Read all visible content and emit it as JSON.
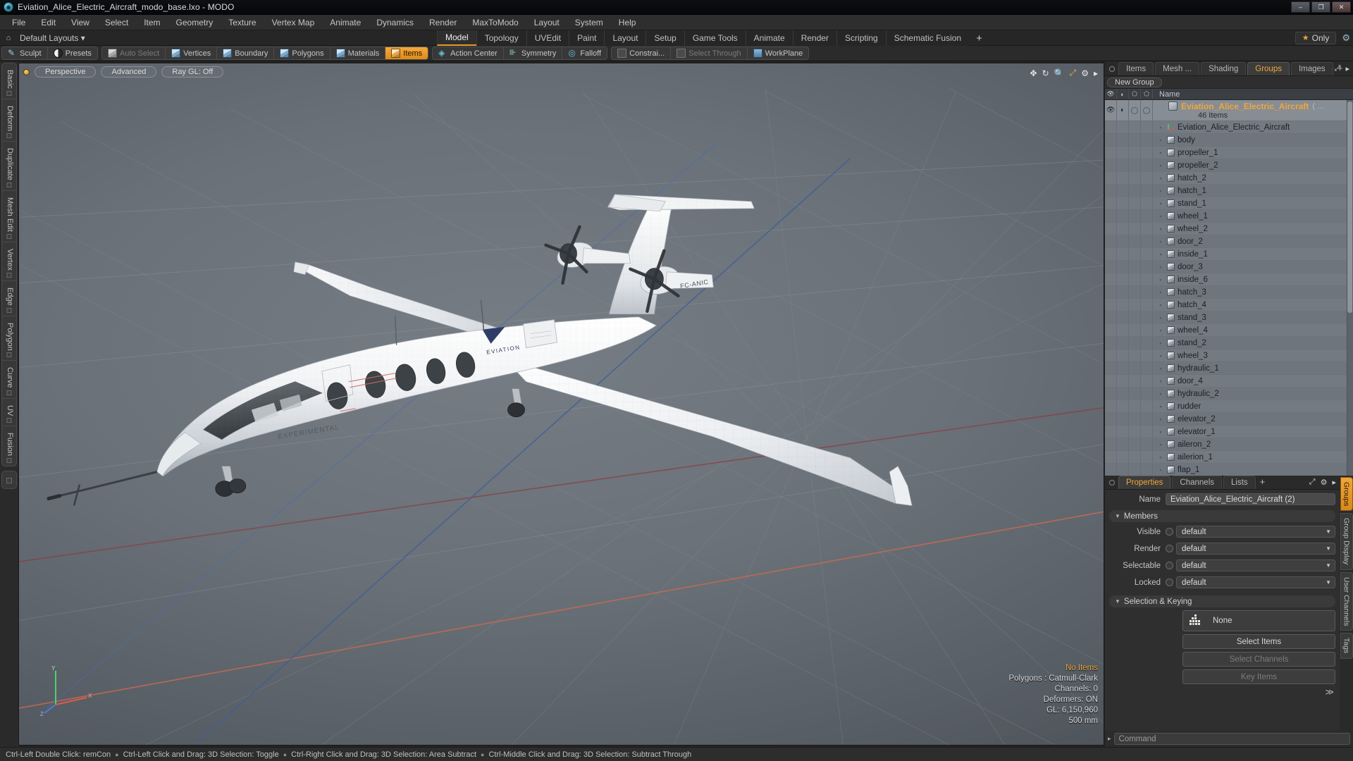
{
  "titlebar": {
    "title": "Eviation_Alice_Electric_Aircraft_modo_base.lxo - MODO",
    "app_icon": "modo-logo-icon",
    "minimize": "–",
    "maximize": "❐",
    "close": "✕"
  },
  "menubar": {
    "items": [
      "File",
      "Edit",
      "View",
      "Select",
      "Item",
      "Geometry",
      "Texture",
      "Vertex Map",
      "Animate",
      "Dynamics",
      "Render",
      "MaxToModo",
      "Layout",
      "System",
      "Help"
    ]
  },
  "layoutbar": {
    "home_icon": "home-icon",
    "layouts_label": "Default Layouts ▾",
    "tabs": [
      {
        "label": "Model",
        "active": true
      },
      {
        "label": "Topology",
        "active": false
      },
      {
        "label": "UVEdit",
        "active": false
      },
      {
        "label": "Paint",
        "active": false
      },
      {
        "label": "Layout",
        "active": false
      },
      {
        "label": "Setup",
        "active": false
      },
      {
        "label": "Game Tools",
        "active": false
      },
      {
        "label": "Animate",
        "active": false
      },
      {
        "label": "Render",
        "active": false
      },
      {
        "label": "Scripting",
        "active": false
      },
      {
        "label": "Schematic Fusion",
        "active": false
      }
    ],
    "add_tab": "+",
    "only_label": "Only",
    "star_icon": "star-icon",
    "gear_icon": "gear-icon"
  },
  "modebar": {
    "group1": [
      {
        "label": "Sculpt",
        "icon": "sculpt-icon",
        "active": false,
        "dim": false
      },
      {
        "label": "Presets",
        "icon": "presets-sphere-icon",
        "active": false,
        "dim": false
      }
    ],
    "group2": [
      {
        "label": "Auto Select",
        "icon": "grey-cube-icon",
        "active": false,
        "dim": true
      },
      {
        "label": "Vertices",
        "icon": "blue-cube-icon",
        "active": false,
        "dim": false
      },
      {
        "label": "Boundary",
        "icon": "blue-cube-icon",
        "active": false,
        "dim": false
      },
      {
        "label": "Polygons",
        "icon": "blue-cube-icon",
        "active": false,
        "dim": false
      },
      {
        "label": "Materials",
        "icon": "blue-cube-icon",
        "active": false,
        "dim": false
      },
      {
        "label": "Items",
        "icon": "orange-cube-icon",
        "active": true,
        "dim": false
      }
    ],
    "group3": [
      {
        "label": "Action Center",
        "icon": "action-center-icon",
        "active": false,
        "dim": false
      },
      {
        "label": "Symmetry",
        "icon": "symmetry-icon",
        "active": false,
        "dim": false
      },
      {
        "label": "Falloff",
        "icon": "falloff-icon",
        "active": false,
        "dim": false
      }
    ],
    "group4": [
      {
        "label": "Constrai...",
        "icon": "constraint-icon",
        "active": false,
        "dim": false
      },
      {
        "label": "Select Through",
        "icon": "select-through-icon",
        "active": false,
        "dim": true
      },
      {
        "label": "WorkPlane",
        "icon": "workplane-icon",
        "active": false,
        "dim": false
      }
    ]
  },
  "left_tabs": {
    "items": [
      "Basic",
      "Deform",
      "Duplicate",
      "Mesh Edit",
      "Vertex",
      "Edge",
      "Polygon",
      "Curve",
      "UV",
      "Fusion"
    ]
  },
  "viewport": {
    "dot_icon": "viewport-active-dot-icon",
    "pills": [
      "Perspective",
      "Advanced",
      "Ray GL: Off"
    ],
    "tool_icons": [
      "move-view-icon",
      "rotate-view-icon",
      "zoom-view-icon",
      "fit-view-icon",
      "gear-icon",
      "chevron-right-icon"
    ],
    "stats": {
      "no_items": "No Items",
      "polygons": "Polygons : Catmull-Clark",
      "channels": "Channels: 0",
      "deformers": "Deformers: ON",
      "gl": "GL: 6,150,960",
      "scale": "500 mm"
    },
    "model_text": {
      "experimental": "EXPERIMENTAL",
      "eviation": "EVIATION",
      "tail_code": "FC-ANIC"
    },
    "axis_labels": [
      "Y",
      "X",
      "Z"
    ]
  },
  "right_panel": {
    "tabs": [
      {
        "label": "Items",
        "active": false
      },
      {
        "label": "Mesh ...",
        "active": false
      },
      {
        "label": "Shading",
        "active": false
      },
      {
        "label": "Groups",
        "active": true
      },
      {
        "label": "Images",
        "active": false
      }
    ],
    "add_tab": "+",
    "corner_icons": [
      "expand-icon",
      "chevron-right-icon"
    ],
    "new_group_label": "New Group",
    "columns": {
      "visible_icon": "eye-icon",
      "render_icon": "render-icon",
      "selectable_icon": "selectable-cube-icon",
      "locked_icon": "locked-cube-icon",
      "name": "Name"
    },
    "group": {
      "name": "Eviation_Alice_Electric_Aircraft",
      "suffix": "( ...",
      "count": "46 Items"
    },
    "items": [
      {
        "name": "Eviation_Alice_Electric_Aircraft",
        "icon": "locator-axis-icon"
      },
      {
        "name": "body",
        "icon": "mesh-cube-icon"
      },
      {
        "name": "propeller_1",
        "icon": "mesh-cube-icon"
      },
      {
        "name": "propeller_2",
        "icon": "mesh-cube-icon"
      },
      {
        "name": "hatch_2",
        "icon": "mesh-cube-icon"
      },
      {
        "name": "hatch_1",
        "icon": "mesh-cube-icon"
      },
      {
        "name": "stand_1",
        "icon": "mesh-cube-icon"
      },
      {
        "name": "wheel_1",
        "icon": "mesh-cube-icon"
      },
      {
        "name": "wheel_2",
        "icon": "mesh-cube-icon"
      },
      {
        "name": "door_2",
        "icon": "mesh-cube-icon"
      },
      {
        "name": "inside_1",
        "icon": "mesh-cube-icon"
      },
      {
        "name": "door_3",
        "icon": "mesh-cube-icon"
      },
      {
        "name": "inside_6",
        "icon": "mesh-cube-icon"
      },
      {
        "name": "hatch_3",
        "icon": "mesh-cube-icon"
      },
      {
        "name": "hatch_4",
        "icon": "mesh-cube-icon"
      },
      {
        "name": "stand_3",
        "icon": "mesh-cube-icon"
      },
      {
        "name": "wheel_4",
        "icon": "mesh-cube-icon"
      },
      {
        "name": "stand_2",
        "icon": "mesh-cube-icon"
      },
      {
        "name": "wheel_3",
        "icon": "mesh-cube-icon"
      },
      {
        "name": "hydraulic_1",
        "icon": "mesh-cube-icon"
      },
      {
        "name": "door_4",
        "icon": "mesh-cube-icon"
      },
      {
        "name": "hydraulic_2",
        "icon": "mesh-cube-icon"
      },
      {
        "name": "rudder",
        "icon": "mesh-cube-icon"
      },
      {
        "name": "elevator_2",
        "icon": "mesh-cube-icon"
      },
      {
        "name": "elevator_1",
        "icon": "mesh-cube-icon"
      },
      {
        "name": "aileron_2",
        "icon": "mesh-cube-icon"
      },
      {
        "name": "ailerion_1",
        "icon": "mesh-cube-icon"
      },
      {
        "name": "flap_1",
        "icon": "mesh-cube-icon"
      }
    ]
  },
  "properties": {
    "tabs": [
      {
        "label": "Properties",
        "active": true
      },
      {
        "label": "Channels",
        "active": false
      },
      {
        "label": "Lists",
        "active": false
      }
    ],
    "add_tab": "+",
    "corner_icons": [
      "expand-icon",
      "gear-icon",
      "chevron-right-icon"
    ],
    "name_label": "Name",
    "name_value": "Eviation_Alice_Electric_Aircraft (2)",
    "members_section": "Members",
    "fields": [
      {
        "label": "Visible",
        "value": "default"
      },
      {
        "label": "Render",
        "value": "default"
      },
      {
        "label": "Selectable",
        "value": "default"
      },
      {
        "label": "Locked",
        "value": "default"
      }
    ],
    "selection_section": "Selection & Keying",
    "none_value": "None",
    "none_icon": "selection-set-icon",
    "buttons": [
      {
        "label": "Select Items",
        "enabled": true
      },
      {
        "label": "Select Channels",
        "enabled": false
      },
      {
        "label": "Key Items",
        "enabled": false
      }
    ],
    "expand_arrow": "≫",
    "vtabs": [
      {
        "label": "Groups",
        "active": true
      },
      {
        "label": "Group Display",
        "active": false
      },
      {
        "label": "User Channels",
        "active": false
      },
      {
        "label": "Tags",
        "active": false
      }
    ]
  },
  "command_bar": {
    "toggle_icon": "chevron-right-icon",
    "placeholder": "Command"
  },
  "statusbar": {
    "hints": [
      "Ctrl-Left Double Click: remCon",
      "Ctrl-Left Click and Drag: 3D Selection: Toggle",
      "Ctrl-Right Click and Drag: 3D Selection: Area Subtract",
      "Ctrl-Middle Click and Drag: 3D Selection: Subtract Through"
    ],
    "separator": "●"
  }
}
